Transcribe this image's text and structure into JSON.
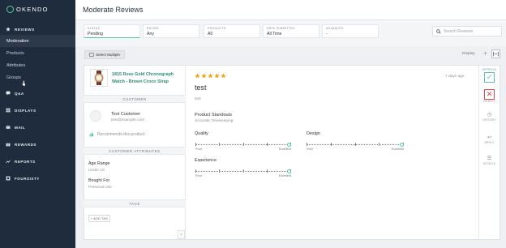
{
  "app": {
    "logo_text": "OKENDO",
    "page_title": "Moderate Reviews"
  },
  "sidebar": {
    "sections": [
      {
        "label": "REVIEWS",
        "icon": "star-icon"
      },
      {
        "label": "Q&A",
        "icon": "chat-icon"
      },
      {
        "label": "DISPLAYS",
        "icon": "grid-icon"
      },
      {
        "label": "MAIL",
        "icon": "mail-icon"
      },
      {
        "label": "REWARDS",
        "icon": "gift-icon"
      },
      {
        "label": "REPORTS",
        "icon": "trend-icon"
      },
      {
        "label": "FOURSIXTY",
        "icon": "square-icon"
      }
    ],
    "review_items": [
      "Moderation",
      "Products",
      "Attributes",
      "Groups"
    ],
    "active_item": "Moderation"
  },
  "filters": [
    {
      "label": "STATUS",
      "value": "Pending"
    },
    {
      "label": "RATING",
      "value": "Any"
    },
    {
      "label": "PRODUCTS",
      "value": "All"
    },
    {
      "label": "DATE SUBMITTED",
      "value": "All Time"
    },
    {
      "label": "ADVANCED",
      "value": "-"
    }
  ],
  "search": {
    "placeholder": "Search Reviews"
  },
  "toolbar": {
    "select_multiple": "Select Multiple",
    "display_label": "Display"
  },
  "product": {
    "name": "1815 Rose Gold Chronograph Watch - Brown Croco Strap"
  },
  "customer": {
    "header": "CUSTOMER",
    "name": "Test Customer",
    "email": "test@example.com",
    "recommends": "Recommends this product"
  },
  "customer_attributes": {
    "header": "CUSTOMER ATTRIBUTES",
    "age_range_label": "Age Range",
    "age_range_value": "Under 18",
    "bought_for_label": "Bought For",
    "bought_for_value": "Personal Use"
  },
  "tags": {
    "header": "TAGS",
    "add_label": "+ ADD TAG"
  },
  "review": {
    "rating": 5,
    "date": "7 days ago",
    "title": "test",
    "body": "test",
    "standouts_label": "Product Standouts",
    "standouts_value": "Accurate Timekeeping",
    "sliders": [
      {
        "label": "Quality",
        "min_label": "Poor",
        "max_label": "Excellent",
        "value": 1.0
      },
      {
        "label": "Design",
        "min_label": "Poor",
        "max_label": "Excellent",
        "value": 1.0
      },
      {
        "label": "Experience",
        "min_label": "Poor",
        "max_label": "Excellent",
        "value": 1.0
      }
    ]
  },
  "actions": {
    "approve": "APPROVE",
    "reject": "REJECT",
    "history": "HISTORY",
    "reply": "REPLY",
    "details": "DETAILS"
  },
  "colors": {
    "sidebar_bg": "#1f2c3d",
    "accent": "#58c7a6",
    "star": "#f0a818",
    "reject": "#e04a4a"
  }
}
